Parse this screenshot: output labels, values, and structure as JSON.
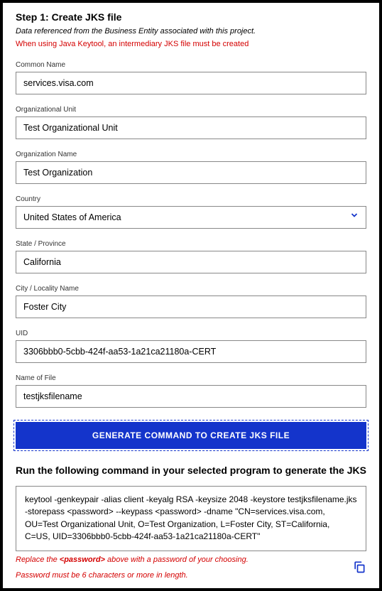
{
  "step": {
    "title": "Step 1: Create JKS file",
    "subtitle": "Data referenced from the Business Entity associated with this project.",
    "warning": "When using Java Keytool, an intermediary JKS file must be created"
  },
  "fields": {
    "commonName": {
      "label": "Common Name",
      "value": "services.visa.com"
    },
    "orgUnit": {
      "label": "Organizational Unit",
      "value": "Test Organizational Unit"
    },
    "orgName": {
      "label": "Organization Name",
      "value": "Test Organization"
    },
    "country": {
      "label": "Country",
      "value": "United States of America"
    },
    "state": {
      "label": "State / Province",
      "value": "California"
    },
    "city": {
      "label": "City / Locality Name",
      "value": "Foster City"
    },
    "uid": {
      "label": "UID",
      "value": "3306bbb0-5cbb-424f-aa53-1a21ca21180a-CERT"
    },
    "filename": {
      "label": "Name of File",
      "value": "testjksfilename"
    }
  },
  "generateButton": "GENERATE COMMAND TO CREATE JKS FILE",
  "runSection": {
    "title": "Run the following command in your selected program to generate the JKS",
    "command": "keytool -genkeypair -alias client -keyalg RSA -keysize 2048 -keystore testjksfilename.jks -storepass <password> --keypass <password> -dname \"CN=services.visa.com, OU=Test Organizational Unit, O=Test Organization, L=Foster City, ST=California, C=US, UID=3306bbb0-5cbb-424f-aa53-1a21ca21180a-CERT\"",
    "note1_prefix": "Replace the ",
    "note1_bold": "<password>",
    "note1_suffix": " above with a password of your choosing.",
    "note2": "Password must be 6 characters or more in length."
  }
}
